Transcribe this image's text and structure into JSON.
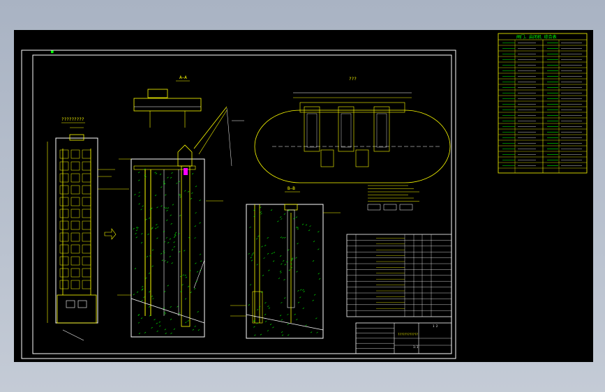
{
  "colors": {
    "background": "#000000",
    "frame": "#ffffff",
    "primary_line": "#ffff00",
    "secondary_line": "#ffffff",
    "hatch": "#00ff00",
    "accent": "#ff00ff",
    "outside": "#b5bdca"
  },
  "drawing": {
    "corner_mark": "■",
    "section_a_title": "A—A",
    "section_b_title": "B—B",
    "top_view_title": "???",
    "left_view_title": "?????????",
    "title_block": {
      "drawing_no": "????????????",
      "scale": "1:1",
      "sheet": "1 2"
    },
    "equipment_table_title": "闸门、启闭机 综合表"
  }
}
